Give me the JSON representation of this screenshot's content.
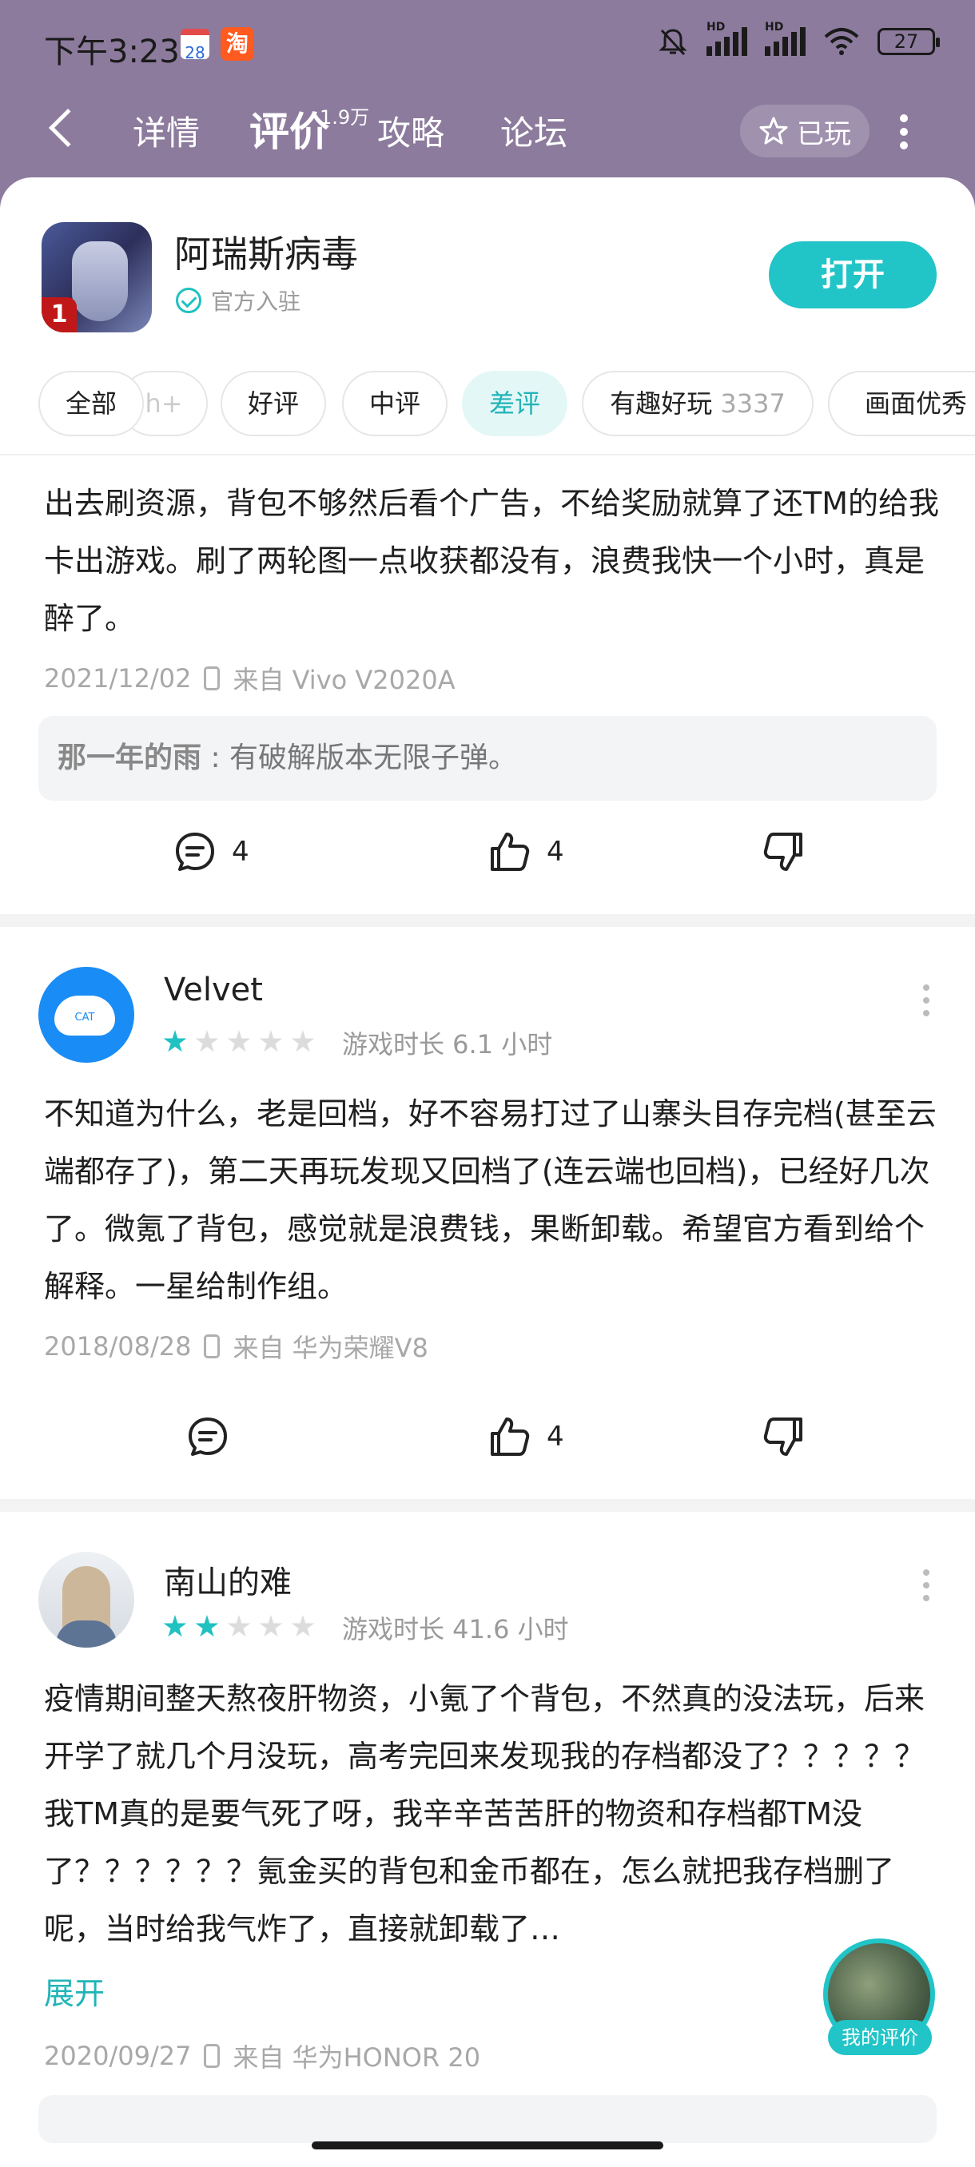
{
  "status": {
    "time": "下午3:23",
    "calendar": "28",
    "taobao": "淘",
    "battery": "27"
  },
  "nav": {
    "tabs": [
      "详情",
      "评价",
      "攻略",
      "论坛"
    ],
    "review_count": "1.9万",
    "played_label": "已玩"
  },
  "app": {
    "name": "阿瑞斯病毒",
    "official": "官方入驻",
    "open_label": "打开",
    "icon_badge": "1"
  },
  "filters": {
    "all": "全部",
    "partial": "h+",
    "good": "好评",
    "mid": "中评",
    "bad": "差评",
    "fun": "有趣好玩",
    "fun_count": "3337",
    "graphics": "画面优秀"
  },
  "review0": {
    "text": "出去刷资源，背包不够然后看个广告，不给奖励就算了还TM的给我卡出游戏。刷了两轮图一点收获都没有，浪费我快一个小时，真是醉了。",
    "date": "2021/12/02",
    "device": "来自 Vivo V2020A",
    "reply_user": "那一年的雨",
    "reply_text": "有破解版本无限子弹。",
    "comments": "4",
    "likes": "4"
  },
  "review1": {
    "user": "Velvet",
    "avatar_text": "CAT",
    "rating": 1,
    "playtime": "游戏时长 6.1 小时",
    "text": "不知道为什么，老是回档，好不容易打过了山寨头目存完档(甚至云端都存了)，第二天再玩发现又回档了(连云端也回档)，已经好几次了。微氪了背包，感觉就是浪费钱，果断卸载。希望官方看到给个解释。一星给制作组。",
    "date": "2018/08/28",
    "device": "来自 华为荣耀V8",
    "likes": "4"
  },
  "review2": {
    "user": "南山的难",
    "rating": 2,
    "playtime": "游戏时长 41.6 小时",
    "text": "疫情期间整天熬夜肝物资，小氪了个背包，不然真的没法玩，后来开学了就几个月没玩，高考完回来发现我的存档都没了？？？？？我TM真的是要气死了呀，我辛辛苦苦肝的物资和存档都TM没了？？？？？？氪金买的背包和金币都在，怎么就把我存档删了呢，当时给我气炸了，直接就卸载了…",
    "expand": "展开",
    "date": "2020/09/27",
    "device": "来自 华为HONOR 20"
  },
  "my_review_label": "我的评价",
  "colors": {
    "accent": "#21c4c7",
    "header": "#8c7b9d"
  }
}
